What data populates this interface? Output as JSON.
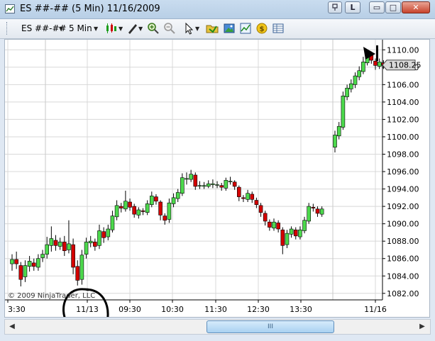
{
  "window": {
    "title": "ES ##-## (5 Min)  11/16/2009",
    "badge": "L",
    "minimize": "▭",
    "maximize": "□",
    "close": "✕"
  },
  "toolbar": {
    "instrument": "ES ##-##",
    "interval": "5 Min",
    "icons": [
      "bar-style-icon",
      "drawing-pen-icon",
      "zoom-in-icon",
      "zoom-out-icon",
      "cursor-select-icon",
      "open-folder-icon",
      "image-icon",
      "chart-data-icon",
      "money-icon",
      "table-icon"
    ]
  },
  "colors": {
    "up": "#4cd94c",
    "down": "#d40000",
    "grid": "#d8d8d8",
    "label_box": "#d9d9d9",
    "annotation": "#000000"
  },
  "chart_data": {
    "type": "candlestick",
    "y_ticks": [
      "1110.00",
      "1108.00",
      "1106.00",
      "1104.00",
      "1102.00",
      "1100.00",
      "1098.00",
      "1096.00",
      "1094.00",
      "1092.00",
      "1090.00",
      "1088.00",
      "1086.00",
      "1084.00",
      "1082.00"
    ],
    "ylim": [
      1081.25,
      1111.0
    ],
    "x_ticks": [
      "3:30",
      "11/13",
      "09:30",
      "10:30",
      "11:30",
      "12:30",
      "13:30",
      "11/16"
    ],
    "last_price": "1108.25",
    "copyright": "© 2009 NinjaTrader, LLC",
    "session1": [
      [
        1085.4,
        1085.9,
        1084.6,
        1086.5
      ],
      [
        1085.9,
        1085.4,
        1084.8,
        1086.8
      ],
      [
        1085.2,
        1083.6,
        1082.8,
        1085.6
      ],
      [
        1083.9,
        1085.2,
        1083.3,
        1085.8
      ],
      [
        1085.1,
        1085.7,
        1084.5,
        1086.3
      ],
      [
        1085.5,
        1085.1,
        1084.6,
        1086.0
      ],
      [
        1085.0,
        1086.0,
        1084.6,
        1086.5
      ],
      [
        1086.1,
        1086.5,
        1085.6,
        1087.0
      ],
      [
        1086.5,
        1087.6,
        1086.0,
        1088.5
      ],
      [
        1087.5,
        1088.3,
        1086.8,
        1089.7
      ],
      [
        1088.1,
        1087.5,
        1086.9,
        1088.7
      ],
      [
        1087.4,
        1087.9,
        1087.0,
        1088.4
      ],
      [
        1087.9,
        1086.9,
        1086.3,
        1088.6
      ],
      [
        1087.0,
        1087.7,
        1086.6,
        1090.4
      ],
      [
        1087.6,
        1085.0,
        1084.2,
        1088.3
      ],
      [
        1085.1,
        1083.5,
        1082.9,
        1085.8
      ],
      [
        1083.6,
        1086.4,
        1083.0,
        1087.0
      ],
      [
        1086.5,
        1087.9,
        1086.0,
        1088.4
      ],
      [
        1087.8,
        1088.0,
        1087.3,
        1088.6
      ],
      [
        1087.9,
        1087.4,
        1086.9,
        1088.3
      ],
      [
        1087.5,
        1089.2,
        1087.1,
        1089.9
      ],
      [
        1089.1,
        1088.4,
        1087.8,
        1089.6
      ],
      [
        1088.5,
        1089.4,
        1088.1,
        1089.9
      ],
      [
        1089.3,
        1090.9,
        1089.0,
        1091.5
      ],
      [
        1090.8,
        1092.1,
        1090.4,
        1092.7
      ],
      [
        1092.0,
        1091.8,
        1091.3,
        1092.4
      ],
      [
        1091.7,
        1092.6,
        1091.4,
        1093.8
      ],
      [
        1092.5,
        1091.9,
        1091.5,
        1092.9
      ],
      [
        1092.0,
        1091.1,
        1090.7,
        1092.3
      ],
      [
        1091.0,
        1091.6,
        1090.6,
        1091.9
      ],
      [
        1091.5,
        1091.4,
        1091.0,
        1091.8
      ],
      [
        1091.3,
        1092.3,
        1091.0,
        1092.7
      ],
      [
        1092.2,
        1093.2,
        1091.9,
        1093.7
      ],
      [
        1093.1,
        1092.6,
        1092.2,
        1093.4
      ],
      [
        1092.5,
        1091.0,
        1090.4,
        1092.7
      ],
      [
        1090.9,
        1090.4,
        1089.9,
        1091.2
      ],
      [
        1090.5,
        1092.4,
        1090.1,
        1092.9
      ],
      [
        1092.3,
        1093.0,
        1091.9,
        1093.5
      ],
      [
        1092.9,
        1093.6,
        1092.5,
        1094.0
      ],
      [
        1093.5,
        1095.3,
        1093.2,
        1095.8
      ],
      [
        1095.2,
        1095.2,
        1094.5,
        1095.9
      ],
      [
        1095.1,
        1095.7,
        1094.8,
        1096.2
      ],
      [
        1095.6,
        1094.3,
        1093.9,
        1095.9
      ],
      [
        1094.4,
        1094.4,
        1094.0,
        1094.9
      ],
      [
        1094.3,
        1094.4,
        1094.0,
        1094.8
      ],
      [
        1094.3,
        1094.6,
        1094.1,
        1095.0
      ],
      [
        1094.5,
        1094.6,
        1094.1,
        1095.1
      ],
      [
        1094.5,
        1094.5,
        1094.1,
        1094.9
      ],
      [
        1094.4,
        1094.2,
        1093.8,
        1094.7
      ],
      [
        1094.1,
        1095.0,
        1093.8,
        1095.3
      ],
      [
        1094.9,
        1094.9,
        1094.5,
        1095.4
      ],
      [
        1094.8,
        1094.3,
        1093.9,
        1095.0
      ],
      [
        1094.2,
        1093.1,
        1092.6,
        1094.4
      ],
      [
        1093.0,
        1092.9,
        1092.5,
        1093.3
      ],
      [
        1092.8,
        1093.5,
        1092.5,
        1093.9
      ],
      [
        1093.4,
        1092.8,
        1092.4,
        1093.7
      ],
      [
        1092.7,
        1092.2,
        1091.8,
        1093.0
      ],
      [
        1092.1,
        1091.3,
        1090.8,
        1092.4
      ],
      [
        1091.2,
        1090.3,
        1089.8,
        1091.5
      ],
      [
        1090.2,
        1089.6,
        1089.2,
        1090.5
      ],
      [
        1089.5,
        1090.2,
        1089.2,
        1090.6
      ],
      [
        1090.1,
        1089.4,
        1089.0,
        1090.4
      ],
      [
        1089.3,
        1087.5,
        1086.5,
        1089.6
      ],
      [
        1087.6,
        1088.9,
        1087.2,
        1089.3
      ],
      [
        1088.8,
        1089.4,
        1088.4,
        1089.7
      ],
      [
        1089.3,
        1088.6,
        1088.2,
        1089.6
      ],
      [
        1088.5,
        1089.3,
        1088.2,
        1089.7
      ],
      [
        1089.2,
        1090.4,
        1088.9,
        1090.8
      ],
      [
        1090.3,
        1092.0,
        1090.0,
        1092.4
      ],
      [
        1091.9,
        1091.8,
        1091.4,
        1092.3
      ],
      [
        1091.7,
        1091.2,
        1090.8,
        1092.0
      ],
      [
        1091.1,
        1091.7,
        1090.8,
        1092.0
      ]
    ],
    "session2": [
      [
        1098.8,
        1100.2,
        1098.2,
        1100.7
      ],
      [
        1100.1,
        1101.2,
        1099.7,
        1101.7
      ],
      [
        1101.1,
        1104.7,
        1100.8,
        1105.2
      ],
      [
        1104.6,
        1105.6,
        1104.2,
        1106.0
      ],
      [
        1105.5,
        1106.1,
        1105.1,
        1106.6
      ],
      [
        1106.0,
        1107.0,
        1105.6,
        1107.4
      ],
      [
        1106.9,
        1107.6,
        1106.5,
        1108.1
      ],
      [
        1107.5,
        1108.6,
        1107.2,
        1109.2
      ],
      [
        1108.5,
        1109.5,
        1108.2,
        1110.0
      ],
      [
        1109.4,
        1108.8,
        1108.4,
        1109.8
      ],
      [
        1108.7,
        1108.2,
        1107.7,
        1109.0
      ],
      [
        1108.1,
        1108.6,
        1107.8,
        1109.0
      ],
      [
        1108.5,
        1108.2,
        1107.8,
        1108.8
      ]
    ]
  }
}
